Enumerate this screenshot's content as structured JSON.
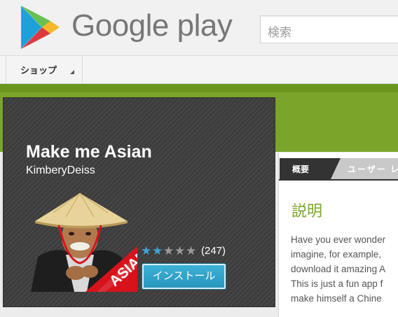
{
  "header": {
    "logo_text": "Google play",
    "search_placeholder": "検索"
  },
  "nav": {
    "shop_label": "ショップ"
  },
  "app": {
    "title": "Make me Asian",
    "developer": "KimberyDeiss",
    "icon_badge_text": "ASIAN",
    "rating": {
      "stars_filled": 2,
      "stars_total": 5,
      "count": "(247)"
    },
    "install_label": "インストール"
  },
  "details": {
    "tabs": [
      {
        "label": "概要",
        "active": true
      },
      {
        "label": "ユーザー レ",
        "active": false
      }
    ],
    "heading": "説明",
    "description_lines": [
      "Have you ever wonder",
      "imagine, for example,",
      "download it amazing A",
      "This is just a fun app f",
      "make himself a Chine"
    ]
  },
  "colors": {
    "brand_green": "#7ba52a",
    "install_blue": "#2896bd",
    "star_blue": "#3fa6d6",
    "card_dark": "#3c3c3c"
  }
}
